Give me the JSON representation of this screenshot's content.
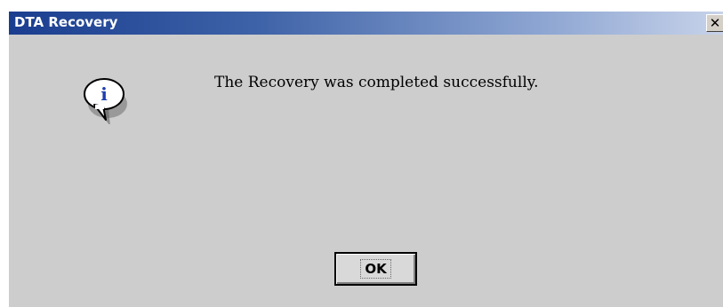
{
  "window": {
    "title": "DTA Recovery",
    "close_glyph": "✕",
    "close_icon": "close-icon"
  },
  "dialog": {
    "icon": "info-icon",
    "icon_letter": "i",
    "message": "The Recovery was completed successfully.",
    "ok_label": "OK"
  },
  "colors": {
    "titlebar_start": "#1a3d8f",
    "titlebar_end": "#c8d3ea",
    "dialog_bg": "#cdcdcd",
    "icon_blue": "#1f3fae"
  }
}
